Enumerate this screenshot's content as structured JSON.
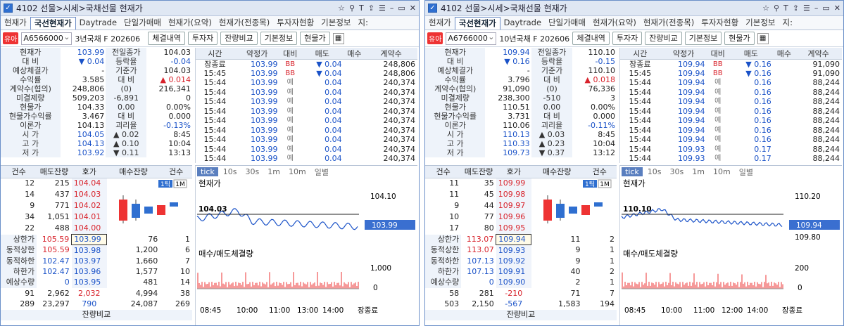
{
  "windows": [
    {
      "title": "4102 선물>시세>국채선물 현재가",
      "tabs": [
        "현재가",
        "국선현재가",
        "Daytrade",
        "단일가매매",
        "현재가(요약)",
        "현재가(전종목)",
        "투자자현황",
        "기본정보",
        "지:"
      ],
      "code": "A6566000",
      "badge": "유아",
      "name": "3년국채 F 202606",
      "buttons": [
        "체결내역",
        "투자자",
        "잔량비교",
        "기본정보",
        "현물가"
      ],
      "price_rows": [
        [
          "현재가",
          "103.99",
          "전일종가",
          "104.03"
        ],
        [
          "대  비",
          "▼ 0.04",
          "등락율",
          "-0.04"
        ],
        [
          "예상체결가",
          "-",
          "기준가",
          "104.03"
        ],
        [
          "수익률",
          "3.585",
          "대  비",
          "▲ 0.014"
        ],
        [
          "계약수(협의)",
          "248,806",
          "(0)",
          "216,341"
        ],
        [
          "미결제량",
          "509,203",
          "-6,891",
          "0"
        ],
        [
          "현물가",
          "104.33",
          "0.00",
          "0.00%"
        ],
        [
          "현물가수익률",
          "3.467",
          "대  비",
          "0.000"
        ],
        [
          "이론가",
          "104.13",
          "괴리율",
          "-0.13%"
        ],
        [
          "시  가",
          "104.05",
          "▲ 0.02",
          "8:45"
        ],
        [
          "고  가",
          "104.13",
          "▲ 0.10",
          "10:04"
        ],
        [
          "저  가",
          "103.92",
          "▼ 0.11",
          "13:13"
        ]
      ],
      "tick_head": [
        "시간",
        "약정가",
        "대비",
        "매도",
        "매수",
        "계약수"
      ],
      "ticks": [
        [
          "장종료",
          "103.99",
          "BB",
          "▼ 0.04",
          "248,806"
        ],
        [
          "15:45",
          "103.99",
          "BB",
          "▼ 0.04",
          "248,806"
        ],
        [
          "15:44",
          "103.99",
          "예",
          "0.04",
          "240,374"
        ],
        [
          "15:44",
          "103.99",
          "예",
          "0.04",
          "240,374"
        ],
        [
          "15:44",
          "103.99",
          "예",
          "0.04",
          "240,374"
        ],
        [
          "15:44",
          "103.99",
          "예",
          "0.04",
          "240,374"
        ],
        [
          "15:44",
          "103.99",
          "예",
          "0.04",
          "240,374"
        ],
        [
          "15:44",
          "103.99",
          "예",
          "0.04",
          "240,374"
        ],
        [
          "15:44",
          "103.99",
          "예",
          "0.04",
          "240,374"
        ],
        [
          "15:44",
          "103.99",
          "예",
          "0.04",
          "240,374"
        ],
        [
          "15:44",
          "103.99",
          "예",
          "0.04",
          "240,374"
        ]
      ],
      "ob_head": [
        "건수",
        "매도잔량",
        "호가",
        "매수잔량",
        "건수"
      ],
      "asks": [
        [
          "12",
          "215",
          "104.04"
        ],
        [
          "14",
          "437",
          "104.03"
        ],
        [
          "9",
          "771",
          "104.02"
        ],
        [
          "34",
          "1,051",
          "104.01"
        ],
        [
          "22",
          "488",
          "104.00"
        ]
      ],
      "bids": [
        [
          "상한가",
          "105.59",
          "103.99",
          "76",
          "1"
        ],
        [
          "동적상한",
          "105.59",
          "103.98",
          "1,200",
          "6"
        ],
        [
          "동적하한",
          "102.47",
          "103.97",
          "1,660",
          "7"
        ],
        [
          "하한가",
          "102.47",
          "103.96",
          "1,577",
          "10"
        ],
        [
          "예상수량",
          "0",
          "103.95",
          "481",
          "14"
        ]
      ],
      "totals": [
        [
          "91",
          "2,962",
          "2,032",
          "4,994",
          "38"
        ],
        [
          "289",
          "23,297",
          "790",
          "24,087",
          "269"
        ]
      ],
      "foot": "잔량비교",
      "chart_tabs": [
        "tick",
        "10s",
        "30s",
        "1m",
        "10m",
        "일별"
      ],
      "chart_label": "현재가",
      "vol_label": "매수/매도체결량",
      "p_hi": "104.10",
      "p_ref": "104.03",
      "p_cur": "103.99",
      "v_hi": "1,000",
      "v_zero": "0",
      "xticks": [
        "08:45",
        "10:00",
        "11:00",
        "13:00",
        "14:00",
        "장종료"
      ],
      "toggles": [
        "1틱",
        "1M"
      ]
    },
    {
      "title": "4102 선물>시세>국채선물 현재가",
      "tabs": [
        "현재가",
        "국선현재가",
        "Daytrade",
        "단일가매매",
        "현재가(요약)",
        "현재가(전종목)",
        "투자자현황",
        "기본정보",
        "지:"
      ],
      "code": "A6766000",
      "badge": "유아",
      "name": "10년국채 F 202606",
      "buttons": [
        "체결내역",
        "투자자",
        "잔량비교",
        "기본정보",
        "현물가"
      ],
      "price_rows": [
        [
          "현재가",
          "109.94",
          "전일종가",
          "110.10"
        ],
        [
          "대  비",
          "▼ 0.16",
          "등락율",
          "-0.15"
        ],
        [
          "예상체결가",
          "-",
          "기준가",
          "110.10"
        ],
        [
          "수익률",
          "3.796",
          "대  비",
          "▲ 0.018"
        ],
        [
          "계약수(협의)",
          "91,090",
          "(0)",
          "76,336"
        ],
        [
          "미결제량",
          "238,300",
          "-510",
          "3"
        ],
        [
          "현물가",
          "110.51",
          "0.00",
          "0.00%"
        ],
        [
          "현물가수익률",
          "3.731",
          "대  비",
          "0.000"
        ],
        [
          "이론가",
          "110.06",
          "괴리율",
          "-0.11%"
        ],
        [
          "시  가",
          "110.13",
          "▲ 0.03",
          "8:45"
        ],
        [
          "고  가",
          "110.33",
          "▲ 0.23",
          "10:04"
        ],
        [
          "저  가",
          "109.73",
          "▼ 0.37",
          "13:12"
        ]
      ],
      "tick_head": [
        "시간",
        "약정가",
        "대비",
        "매도",
        "매수",
        "계약수"
      ],
      "ticks": [
        [
          "장종료",
          "109.94",
          "BB",
          "▼ 0.16",
          "91,090"
        ],
        [
          "15:45",
          "109.94",
          "BB",
          "▼ 0.16",
          "91,090"
        ],
        [
          "15:44",
          "109.94",
          "예",
          "0.16",
          "88,244"
        ],
        [
          "15:44",
          "109.94",
          "예",
          "0.16",
          "88,244"
        ],
        [
          "15:44",
          "109.94",
          "예",
          "0.16",
          "88,244"
        ],
        [
          "15:44",
          "109.94",
          "예",
          "0.16",
          "88,244"
        ],
        [
          "15:44",
          "109.94",
          "예",
          "0.16",
          "88,244"
        ],
        [
          "15:44",
          "109.94",
          "예",
          "0.16",
          "88,244"
        ],
        [
          "15:44",
          "109.94",
          "예",
          "0.16",
          "88,244"
        ],
        [
          "15:44",
          "109.93",
          "예",
          "0.17",
          "88,244"
        ],
        [
          "15:44",
          "109.93",
          "예",
          "0.17",
          "88,244"
        ]
      ],
      "ob_head": [
        "건수",
        "매도잔량",
        "호가",
        "매수잔량",
        "건수"
      ],
      "asks": [
        [
          "11",
          "35",
          "109.99"
        ],
        [
          "11",
          "45",
          "109.98"
        ],
        [
          "9",
          "44",
          "109.97"
        ],
        [
          "10",
          "77",
          "109.96"
        ],
        [
          "17",
          "80",
          "109.95"
        ]
      ],
      "bids": [
        [
          "상한가",
          "113.07",
          "109.94",
          "11",
          "2"
        ],
        [
          "동적상한",
          "113.07",
          "109.93",
          "9",
          "1"
        ],
        [
          "동적하한",
          "107.13",
          "109.92",
          "9",
          "1"
        ],
        [
          "하한가",
          "107.13",
          "109.91",
          "40",
          "2"
        ],
        [
          "예상수량",
          "0",
          "109.90",
          "2",
          "1"
        ]
      ],
      "totals": [
        [
          "58",
          "281",
          "-210",
          "71",
          "7"
        ],
        [
          "503",
          "2,150",
          "-567",
          "1,583",
          "194"
        ]
      ],
      "foot": "잔량비교",
      "chart_tabs": [
        "tick",
        "10s",
        "30s",
        "1m",
        "10m",
        "일별"
      ],
      "chart_label": "현재가",
      "vol_label": "매수/매도체결량",
      "p_hi": "110.20",
      "p_ref": "110.10",
      "p_cur": "109.94",
      "p_lo": "109.80",
      "v_hi": "200",
      "v_zero": "0",
      "xticks": [
        "08:45",
        "10:00",
        "11:00",
        "12:00",
        "14:00",
        "장종료"
      ],
      "toggles": [
        "1틱",
        "1M"
      ]
    }
  ]
}
